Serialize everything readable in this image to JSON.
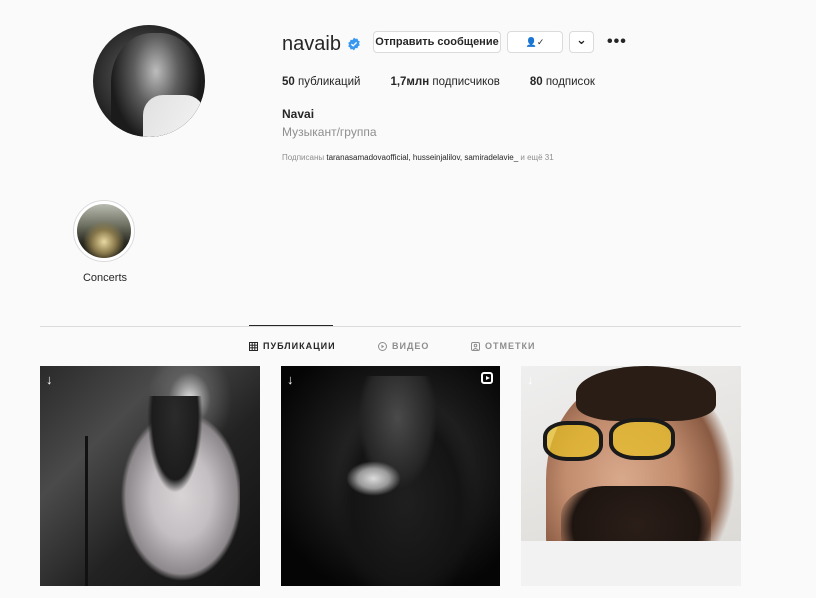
{
  "profile": {
    "username": "navaib",
    "buttons": {
      "message": "Отправить сообщение",
      "follow_icon": "👤✓",
      "more_chevron": "⌄",
      "options": "•••"
    },
    "stats": {
      "posts_count": "50",
      "posts_label": "публикаций",
      "followers_count": "1,7млн",
      "followers_label": "подписчиков",
      "following_count": "80",
      "following_label": "подписок"
    },
    "full_name": "Navai",
    "category": "Музыкант/группа",
    "followed_by": {
      "prefix": "Подписаны",
      "users": "taranasamadovaofficial, husseinjalilov, samiradelavie_",
      "suffix": "и ещё 31"
    }
  },
  "highlights": [
    {
      "label": "Concerts"
    }
  ],
  "tabs": {
    "posts": "ПУБЛИКАЦИИ",
    "video": "ВИДЕО",
    "tagged": "ОТМЕТКИ"
  },
  "icons": {
    "verified": "verified-badge-icon",
    "grid": "grid-icon",
    "video": "video-icon",
    "tagged": "tagged-icon",
    "download": "download-icon",
    "reel": "reel-icon"
  },
  "colors": {
    "verified_blue": "#3897f0",
    "text": "#262626",
    "muted": "#8e8e8e",
    "border": "#dbdbdb"
  }
}
